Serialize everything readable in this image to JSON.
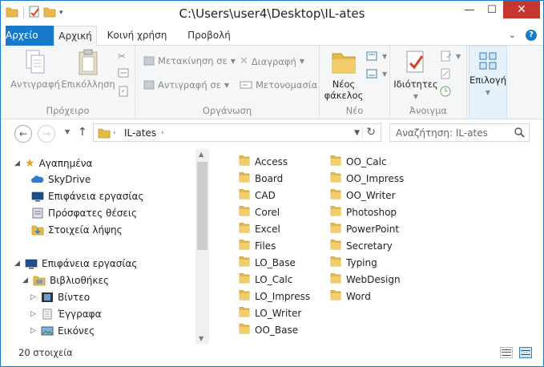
{
  "window": {
    "title": "C:\\Users\\user4\\Desktop\\IL-ates",
    "minimize": "—",
    "maximize": "☐",
    "close": "✕"
  },
  "tabs": {
    "file": "Αρχείο",
    "home": "Αρχική",
    "share": "Κοινή χρήση",
    "view": "Προβολή"
  },
  "ribbon": {
    "clipboard": {
      "label": "Πρόχειρο",
      "copy": "Αντιγραφή",
      "paste": "Επικόλληση"
    },
    "organize": {
      "label": "Οργάνωση",
      "move_to": "Μετακίνηση σε",
      "copy_to": "Αντιγραφή σε",
      "delete": "Διαγραφή",
      "rename": "Μετονομασία"
    },
    "new": {
      "label": "Νέο",
      "new_folder_line1": "Νέος",
      "new_folder_line2": "φάκελος"
    },
    "open": {
      "label": "Άνοιγμα",
      "properties": "Ιδιότητες"
    },
    "select": {
      "label": "Επιλογή"
    }
  },
  "navbar": {
    "address": "IL-ates",
    "search_placeholder": "Αναζήτηση: IL-ates"
  },
  "navpane": {
    "items": [
      {
        "label": "Αγαπημένα",
        "icon": "star-icon"
      },
      {
        "label": "SkyDrive",
        "icon": "skydrive-icon"
      },
      {
        "label": "Επιφάνεια εργασίας",
        "icon": "desktop-icon"
      },
      {
        "label": "Πρόσφατες θέσεις",
        "icon": "recent-places-icon"
      },
      {
        "label": "Στοιχεία λήψης",
        "icon": "downloads-icon"
      },
      {
        "label": "Επιφάνεια εργασίας",
        "icon": "desktop-icon"
      },
      {
        "label": "Βιβλιοθήκες",
        "icon": "libraries-icon"
      },
      {
        "label": "Βίντεο",
        "icon": "videos-icon"
      },
      {
        "label": "Έγγραφα",
        "icon": "documents-icon"
      },
      {
        "label": "Εικόνες",
        "icon": "pictures-icon"
      }
    ]
  },
  "files": {
    "col1": [
      "Access",
      "Board",
      "CAD",
      "Corel",
      "Excel",
      "Files",
      "LO_Base",
      "LO_Calc",
      "LO_Impress",
      "LO_Writer",
      "OO_Base"
    ],
    "col2": [
      "OO_Calc",
      "OO_Impress",
      "OO_Writer",
      "Photoshop",
      "PowerPoint",
      "Secretary",
      "Typing",
      "WebDesign",
      "Word"
    ]
  },
  "status": {
    "count": "20 στοιχεία"
  },
  "colors": {
    "accent": "#1979ca",
    "folder": "#e8b84a",
    "close": "#c7372f"
  }
}
